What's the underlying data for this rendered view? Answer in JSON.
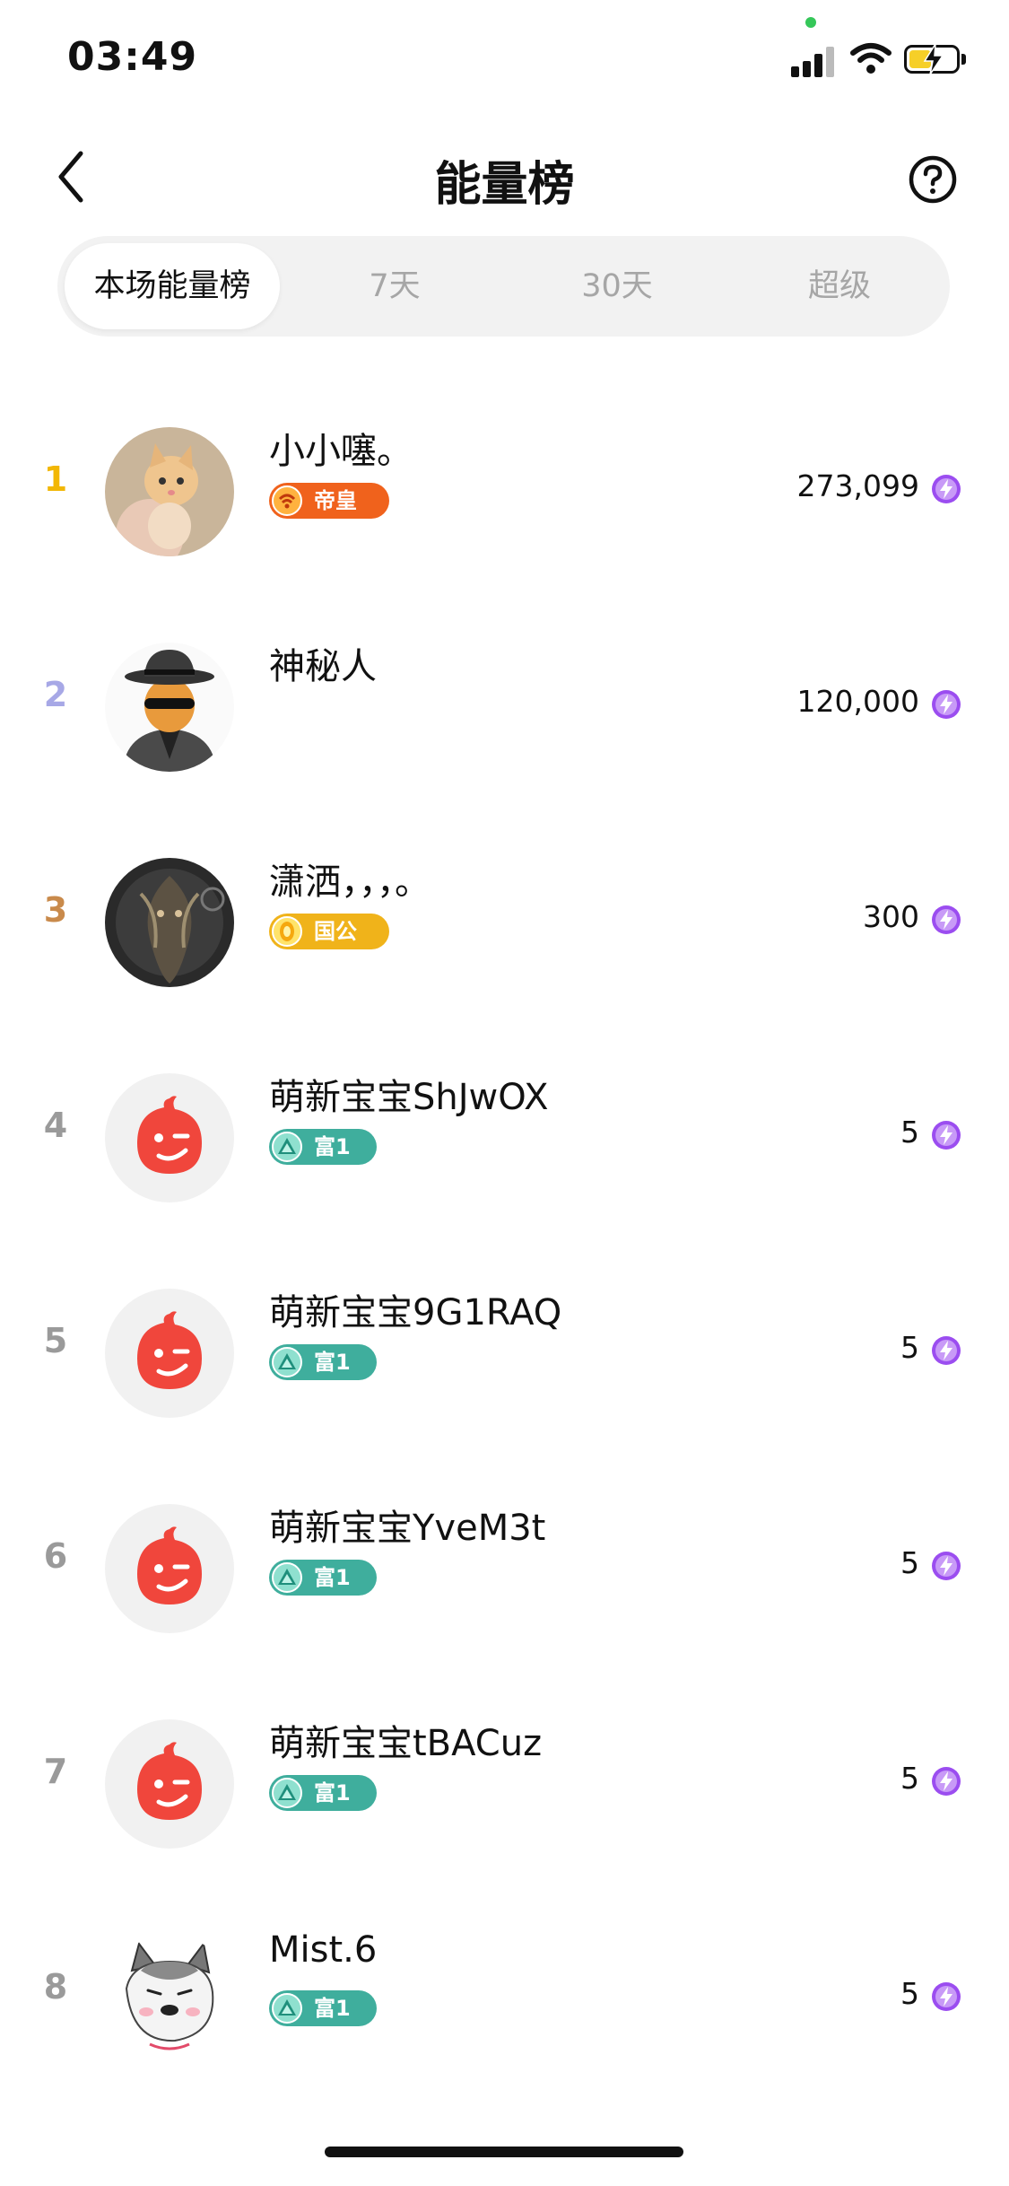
{
  "status_bar": {
    "time": "03:49"
  },
  "header": {
    "title": "能量榜"
  },
  "tabs": [
    {
      "label": "本场能量榜",
      "active": true
    },
    {
      "label": "7天",
      "active": false
    },
    {
      "label": "30天",
      "active": false
    },
    {
      "label": "超级",
      "active": false
    }
  ],
  "ranking": [
    {
      "rank": "1",
      "name": "小小噻。",
      "badge": "帝皇",
      "score": "273,099"
    },
    {
      "rank": "2",
      "name": "神秘人",
      "badge": "",
      "score": "120,000"
    },
    {
      "rank": "3",
      "name": "潇洒，，，。",
      "badge": "国公",
      "score": "300"
    },
    {
      "rank": "4",
      "name": "萌新宝宝ShJwOX",
      "badge": "富1",
      "score": "5"
    },
    {
      "rank": "5",
      "name": "萌新宝宝9G1RAQ",
      "badge": "富1",
      "score": "5"
    },
    {
      "rank": "6",
      "name": "萌新宝宝YveM3t",
      "badge": "富1",
      "score": "5"
    },
    {
      "rank": "7",
      "name": "萌新宝宝tBACuz",
      "badge": "富1",
      "score": "5"
    },
    {
      "rank": "8",
      "name": "Mist.6",
      "badge": "富1",
      "score": "5"
    }
  ],
  "colors": {
    "rank_1": "#f2b705",
    "rank_2": "#a7a8e6",
    "rank_3": "#c98a4b",
    "rank_other": "#9a9a9a",
    "badge_emperor": "#f0621c",
    "badge_duke": "#f0b31a",
    "badge_rich": "#3fae9d",
    "energy_icon": "#9b4df0",
    "avatar_default": "#f0463c"
  },
  "icons": [
    "back-arrow-icon",
    "help-icon",
    "energy-icon",
    "signal-icon",
    "wifi-icon",
    "battery-charging-icon"
  ]
}
